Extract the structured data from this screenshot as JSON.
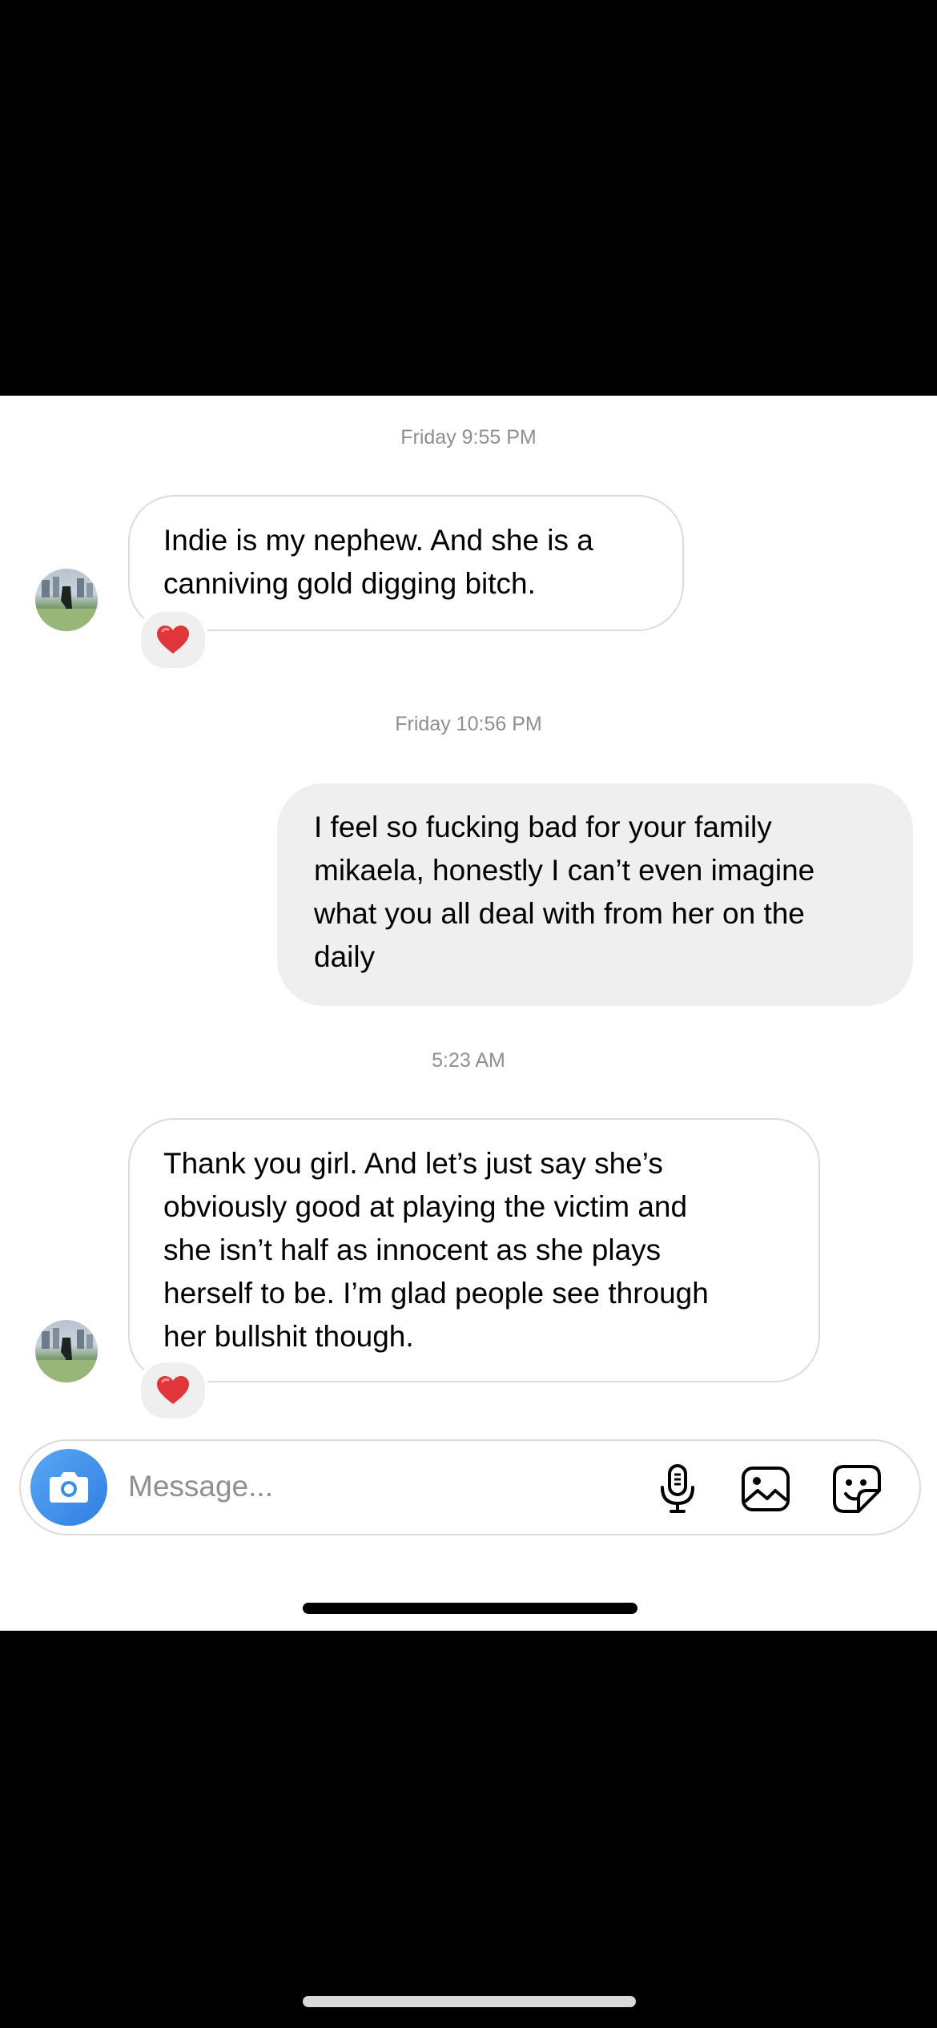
{
  "thread": {
    "timestamps": [
      "Friday 9:55 PM",
      "Friday 10:56 PM",
      "5:23 AM"
    ],
    "messages": [
      {
        "direction": "incoming",
        "lines": [
          "Indie is my nephew. And she is a",
          "canniving gold digging bitch."
        ],
        "reaction": "heart-emoji"
      },
      {
        "direction": "outgoing",
        "lines": [
          "I feel so fucking bad for your family",
          "mikaela, honestly I can’t even imagine",
          "what you all deal with from her on the",
          "daily"
        ]
      },
      {
        "direction": "incoming",
        "lines": [
          "Thank you girl. And let’s just say she’s",
          "obviously good at playing the victim and",
          "she isn’t half as innocent as she plays",
          "herself to be. I’m glad people see through",
          "her bullshit though."
        ],
        "reaction": "heart-emoji"
      }
    ]
  },
  "composer": {
    "placeholder": "Message...",
    "icons": [
      "camera-icon",
      "microphone-icon",
      "gallery-icon",
      "sticker-icon"
    ]
  },
  "colors": {
    "incoming_bubble": "#ffffff",
    "outgoing_bubble": "#efefef",
    "camera_button": "#3a8ee6",
    "timestamp": "#8e8e93",
    "reaction_heart": "#e0353a"
  }
}
